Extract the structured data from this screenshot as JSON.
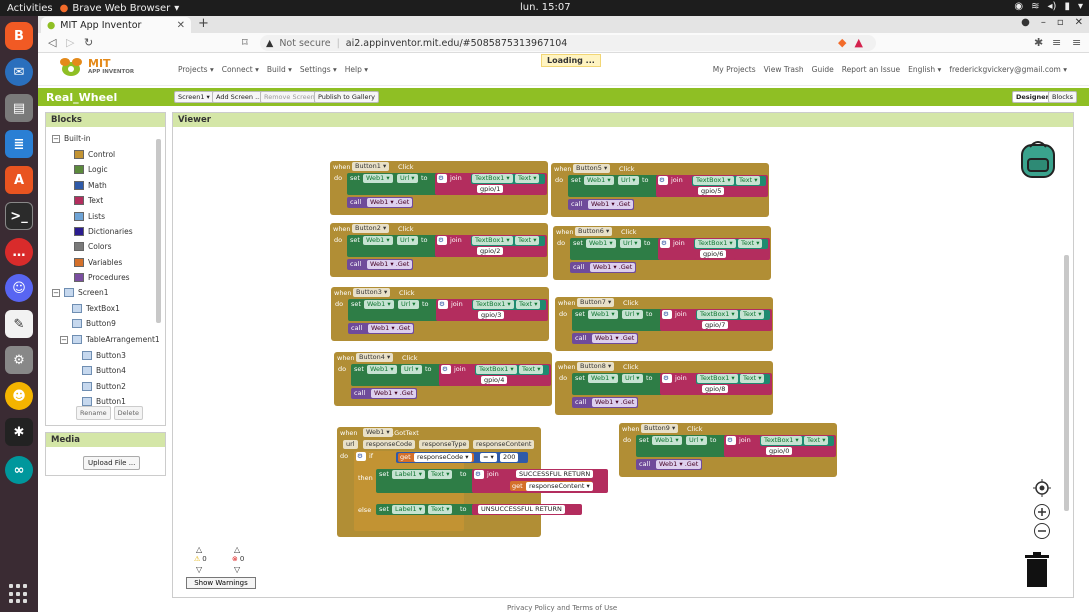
{
  "system": {
    "activities": "Activities",
    "app_name": "Brave Web Browser",
    "clock": "lun. 15:07"
  },
  "browser": {
    "tab_title": "MIT App Inventor",
    "new_tab": "+",
    "security_label": "Not secure",
    "url": "ai2.appinventor.mit.edu/#5085875313967104"
  },
  "appinventor": {
    "logo_title": "MIT",
    "logo_sub": "APP INVENTOR",
    "menus": [
      "Projects ▾",
      "Connect ▾",
      "Build ▾",
      "Settings ▾",
      "Help ▾"
    ],
    "loading": "Loading ...",
    "right_links": [
      "My Projects",
      "View Trash",
      "Guide",
      "Report an Issue",
      "English ▾",
      "frederickgvickery@gmail.com ▾"
    ],
    "project_name": "Real_Wheel",
    "screen_btn": "Screen1 ▾",
    "add_screen": "Add Screen ...",
    "remove_screen": "Remove Screen",
    "publish": "Publish to Gallery",
    "designer": "Designer",
    "blocks_btn": "Blocks"
  },
  "palette": {
    "title": "Blocks",
    "builtin": "Built-in",
    "builtin_items": [
      {
        "label": "Control",
        "color": "#c29333"
      },
      {
        "label": "Logic",
        "color": "#5b8a3c"
      },
      {
        "label": "Math",
        "color": "#2f5aa8"
      },
      {
        "label": "Text",
        "color": "#b32d5e"
      },
      {
        "label": "Lists",
        "color": "#6fa4d6"
      },
      {
        "label": "Dictionaries",
        "color": "#2b1c8f"
      },
      {
        "label": "Colors",
        "color": "#7a7a7a"
      },
      {
        "label": "Variables",
        "color": "#d4702a"
      },
      {
        "label": "Procedures",
        "color": "#7a4ea0"
      }
    ],
    "screen": "Screen1",
    "screen_items": [
      "TextBox1",
      "Button9"
    ],
    "table": "TableArrangement1",
    "table_items": [
      "Button3",
      "Button4",
      "Button2",
      "Button1"
    ],
    "rename": "Rename",
    "delete": "Delete",
    "media_title": "Media",
    "upload": "Upload File ..."
  },
  "viewer": {
    "title": "Viewer",
    "show_warnings": "Show Warnings",
    "warnings_count": "0",
    "errors_count": "0"
  },
  "blocks": {
    "when": "when",
    "do": "do",
    "click": "Click",
    "set": "set",
    "web": "Web1 ▾",
    "url": "Url ▾",
    "to": "to",
    "join": "join",
    "textbox": "TextBox1 ▾",
    "text": "Text ▾",
    "call": "call",
    "get_method": "Web1 ▾ .Get",
    "buttons": [
      {
        "name": "Button1 ▾",
        "gpio": "gpio/1"
      },
      {
        "name": "Button2 ▾",
        "gpio": "gpio/2"
      },
      {
        "name": "Button3 ▾",
        "gpio": "gpio/3"
      },
      {
        "name": "Button4 ▾",
        "gpio": "gpio/4"
      },
      {
        "name": "Button5 ▾",
        "gpio": "gpio/5"
      },
      {
        "name": "Button6 ▾",
        "gpio": "gpio/6"
      },
      {
        "name": "Button7 ▾",
        "gpio": "gpio/7"
      },
      {
        "name": "Button8 ▾",
        "gpio": "gpio/8"
      },
      {
        "name": "Button9 ▾",
        "gpio": "gpio/0"
      }
    ],
    "gottext": {
      "event": "Web1 ▾",
      "method": ".GotText",
      "params": [
        "url",
        "responseCode",
        "responseType",
        "responseContent"
      ],
      "if": "if",
      "then": "then",
      "else": "else",
      "get": "get",
      "get_var": "responseCode ▾",
      "op": "= ▾",
      "value": "200",
      "label": "Label1 ▾",
      "success": "SUCCESSFUL RETURN",
      "content_var": "responseContent ▾",
      "fail": "UNSUCCESSFUL RETURN"
    }
  },
  "footer": "Privacy Policy and Terms of Use"
}
